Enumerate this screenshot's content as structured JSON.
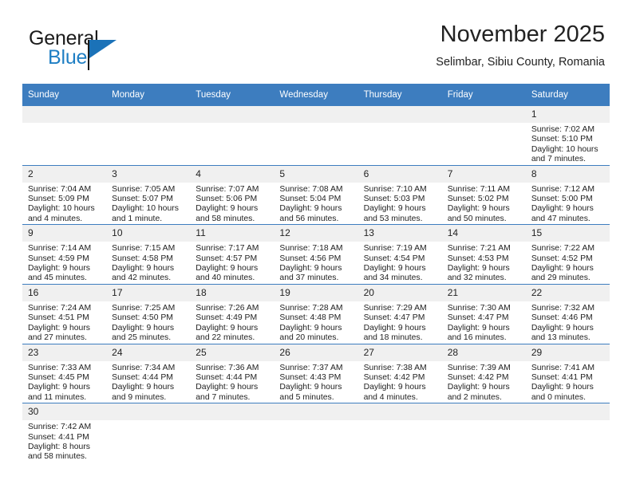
{
  "brand": {
    "name_top": "General",
    "name_bottom": "Blue",
    "triangle_color": "#1b72b8",
    "blue_text_color": "#1f7fc4"
  },
  "header": {
    "title": "November 2025",
    "subtitle": "Selimbar, Sibiu County, Romania"
  },
  "theme": {
    "header_row_bg": "#3d7dbf",
    "header_row_text": "#ffffff",
    "daynum_bg": "#f0f0f0",
    "grid_line": "#3d7dbf",
    "body_text": "#222222"
  },
  "weekday_headers": [
    "Sunday",
    "Monday",
    "Tuesday",
    "Wednesday",
    "Thursday",
    "Friday",
    "Saturday"
  ],
  "weeks": [
    [
      {
        "day": "",
        "blank": true,
        "lines": []
      },
      {
        "day": "",
        "blank": true,
        "lines": []
      },
      {
        "day": "",
        "blank": true,
        "lines": []
      },
      {
        "day": "",
        "blank": true,
        "lines": []
      },
      {
        "day": "",
        "blank": true,
        "lines": []
      },
      {
        "day": "",
        "blank": true,
        "lines": []
      },
      {
        "day": "1",
        "blank": false,
        "lines": [
          "Sunrise: 7:02 AM",
          "Sunset: 5:10 PM",
          "Daylight: 10 hours",
          "and 7 minutes."
        ]
      }
    ],
    [
      {
        "day": "2",
        "blank": false,
        "lines": [
          "Sunrise: 7:04 AM",
          "Sunset: 5:09 PM",
          "Daylight: 10 hours",
          "and 4 minutes."
        ]
      },
      {
        "day": "3",
        "blank": false,
        "lines": [
          "Sunrise: 7:05 AM",
          "Sunset: 5:07 PM",
          "Daylight: 10 hours",
          "and 1 minute."
        ]
      },
      {
        "day": "4",
        "blank": false,
        "lines": [
          "Sunrise: 7:07 AM",
          "Sunset: 5:06 PM",
          "Daylight: 9 hours",
          "and 58 minutes."
        ]
      },
      {
        "day": "5",
        "blank": false,
        "lines": [
          "Sunrise: 7:08 AM",
          "Sunset: 5:04 PM",
          "Daylight: 9 hours",
          "and 56 minutes."
        ]
      },
      {
        "day": "6",
        "blank": false,
        "lines": [
          "Sunrise: 7:10 AM",
          "Sunset: 5:03 PM",
          "Daylight: 9 hours",
          "and 53 minutes."
        ]
      },
      {
        "day": "7",
        "blank": false,
        "lines": [
          "Sunrise: 7:11 AM",
          "Sunset: 5:02 PM",
          "Daylight: 9 hours",
          "and 50 minutes."
        ]
      },
      {
        "day": "8",
        "blank": false,
        "lines": [
          "Sunrise: 7:12 AM",
          "Sunset: 5:00 PM",
          "Daylight: 9 hours",
          "and 47 minutes."
        ]
      }
    ],
    [
      {
        "day": "9",
        "blank": false,
        "lines": [
          "Sunrise: 7:14 AM",
          "Sunset: 4:59 PM",
          "Daylight: 9 hours",
          "and 45 minutes."
        ]
      },
      {
        "day": "10",
        "blank": false,
        "lines": [
          "Sunrise: 7:15 AM",
          "Sunset: 4:58 PM",
          "Daylight: 9 hours",
          "and 42 minutes."
        ]
      },
      {
        "day": "11",
        "blank": false,
        "lines": [
          "Sunrise: 7:17 AM",
          "Sunset: 4:57 PM",
          "Daylight: 9 hours",
          "and 40 minutes."
        ]
      },
      {
        "day": "12",
        "blank": false,
        "lines": [
          "Sunrise: 7:18 AM",
          "Sunset: 4:56 PM",
          "Daylight: 9 hours",
          "and 37 minutes."
        ]
      },
      {
        "day": "13",
        "blank": false,
        "lines": [
          "Sunrise: 7:19 AM",
          "Sunset: 4:54 PM",
          "Daylight: 9 hours",
          "and 34 minutes."
        ]
      },
      {
        "day": "14",
        "blank": false,
        "lines": [
          "Sunrise: 7:21 AM",
          "Sunset: 4:53 PM",
          "Daylight: 9 hours",
          "and 32 minutes."
        ]
      },
      {
        "day": "15",
        "blank": false,
        "lines": [
          "Sunrise: 7:22 AM",
          "Sunset: 4:52 PM",
          "Daylight: 9 hours",
          "and 29 minutes."
        ]
      }
    ],
    [
      {
        "day": "16",
        "blank": false,
        "lines": [
          "Sunrise: 7:24 AM",
          "Sunset: 4:51 PM",
          "Daylight: 9 hours",
          "and 27 minutes."
        ]
      },
      {
        "day": "17",
        "blank": false,
        "lines": [
          "Sunrise: 7:25 AM",
          "Sunset: 4:50 PM",
          "Daylight: 9 hours",
          "and 25 minutes."
        ]
      },
      {
        "day": "18",
        "blank": false,
        "lines": [
          "Sunrise: 7:26 AM",
          "Sunset: 4:49 PM",
          "Daylight: 9 hours",
          "and 22 minutes."
        ]
      },
      {
        "day": "19",
        "blank": false,
        "lines": [
          "Sunrise: 7:28 AM",
          "Sunset: 4:48 PM",
          "Daylight: 9 hours",
          "and 20 minutes."
        ]
      },
      {
        "day": "20",
        "blank": false,
        "lines": [
          "Sunrise: 7:29 AM",
          "Sunset: 4:47 PM",
          "Daylight: 9 hours",
          "and 18 minutes."
        ]
      },
      {
        "day": "21",
        "blank": false,
        "lines": [
          "Sunrise: 7:30 AM",
          "Sunset: 4:47 PM",
          "Daylight: 9 hours",
          "and 16 minutes."
        ]
      },
      {
        "day": "22",
        "blank": false,
        "lines": [
          "Sunrise: 7:32 AM",
          "Sunset: 4:46 PM",
          "Daylight: 9 hours",
          "and 13 minutes."
        ]
      }
    ],
    [
      {
        "day": "23",
        "blank": false,
        "lines": [
          "Sunrise: 7:33 AM",
          "Sunset: 4:45 PM",
          "Daylight: 9 hours",
          "and 11 minutes."
        ]
      },
      {
        "day": "24",
        "blank": false,
        "lines": [
          "Sunrise: 7:34 AM",
          "Sunset: 4:44 PM",
          "Daylight: 9 hours",
          "and 9 minutes."
        ]
      },
      {
        "day": "25",
        "blank": false,
        "lines": [
          "Sunrise: 7:36 AM",
          "Sunset: 4:44 PM",
          "Daylight: 9 hours",
          "and 7 minutes."
        ]
      },
      {
        "day": "26",
        "blank": false,
        "lines": [
          "Sunrise: 7:37 AM",
          "Sunset: 4:43 PM",
          "Daylight: 9 hours",
          "and 5 minutes."
        ]
      },
      {
        "day": "27",
        "blank": false,
        "lines": [
          "Sunrise: 7:38 AM",
          "Sunset: 4:42 PM",
          "Daylight: 9 hours",
          "and 4 minutes."
        ]
      },
      {
        "day": "28",
        "blank": false,
        "lines": [
          "Sunrise: 7:39 AM",
          "Sunset: 4:42 PM",
          "Daylight: 9 hours",
          "and 2 minutes."
        ]
      },
      {
        "day": "29",
        "blank": false,
        "lines": [
          "Sunrise: 7:41 AM",
          "Sunset: 4:41 PM",
          "Daylight: 9 hours",
          "and 0 minutes."
        ]
      }
    ],
    [
      {
        "day": "30",
        "blank": false,
        "lines": [
          "Sunrise: 7:42 AM",
          "Sunset: 4:41 PM",
          "Daylight: 8 hours",
          "and 58 minutes."
        ]
      },
      {
        "day": "",
        "blank": true,
        "lines": []
      },
      {
        "day": "",
        "blank": true,
        "lines": []
      },
      {
        "day": "",
        "blank": true,
        "lines": []
      },
      {
        "day": "",
        "blank": true,
        "lines": []
      },
      {
        "day": "",
        "blank": true,
        "lines": []
      },
      {
        "day": "",
        "blank": true,
        "lines": []
      }
    ]
  ]
}
